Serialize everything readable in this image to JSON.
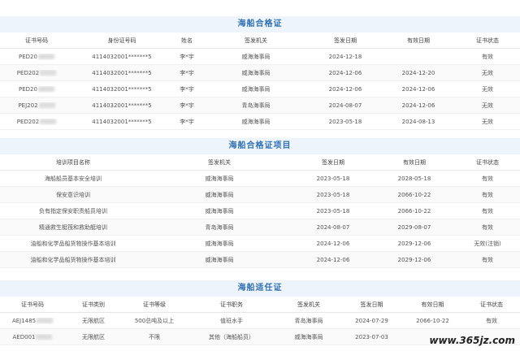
{
  "sec1": {
    "title": "海船合格证",
    "headers": [
      "证书号码",
      "身份证号码",
      "姓名",
      "签发机关",
      "签发日期",
      "有效日期",
      "证书状态"
    ],
    "rows": [
      [
        "PED20",
        "4114032001*******5",
        "李*宇",
        "威海海事局",
        "2024-12-18",
        "",
        "有效"
      ],
      [
        "PED202",
        "4114032001*******5",
        "李*宇",
        "威海海事局",
        "2024-12-06",
        "2024-12-20",
        "无效"
      ],
      [
        "PED20",
        "4114032001*******5",
        "李*宇",
        "威海海事局",
        "2024-12-06",
        "2024-12-06",
        "无效"
      ],
      [
        "PEJ202",
        "4114032001*******5",
        "李*宇",
        "青岛海事局",
        "2024-08-07",
        "2024-12-06",
        "无效"
      ],
      [
        "PED202",
        "4114032001*******5",
        "李*宇",
        "威海海事局",
        "2023-05-18",
        "2024-08-13",
        "无效"
      ]
    ]
  },
  "sec2": {
    "title": "海船合格证项目",
    "headers": [
      "培训项目名称",
      "签发机关",
      "签发日期",
      "有效日期",
      "证书状态"
    ],
    "rows": [
      [
        "海船船员基本安全培训",
        "威海海事局",
        "2023-05-18",
        "2028-05-18",
        "有效"
      ],
      [
        "保安意识培训",
        "威海海事局",
        "2023-05-18",
        "2066-10-22",
        "有效"
      ],
      [
        "负有指定保安职责船员培训",
        "威海海事局",
        "2023-05-18",
        "2066-10-22",
        "有效"
      ],
      [
        "精通救生艇筏和救助艇培训",
        "青岛海事局",
        "2024-08-07",
        "2029-08-07",
        "有效"
      ],
      [
        "油船和化学品船货物操作基本培训",
        "威海海事局",
        "2024-12-06",
        "2029-12-06",
        "无效(注销)"
      ],
      [
        "油船和化学品船货物操作基本培训",
        "威海海事局",
        "2024-12-06",
        "2029-12-06",
        "有效"
      ]
    ]
  },
  "sec3": {
    "title": "海船适任证",
    "headers": [
      "证书号码",
      "证书类别",
      "证书等级",
      "证书职务",
      "签发机关",
      "签发日期",
      "有效日期",
      "证书状态"
    ],
    "rows": [
      [
        "AEJ1485",
        "无限航区",
        "500总吨及以上",
        "值班水手",
        "青岛海事局",
        "2024-07-29",
        "2066-10-22",
        "有效"
      ],
      [
        "AED001",
        "无限航区",
        "不限",
        "其他（海船船员）",
        "威海海事局",
        "2023-07-03",
        "",
        ""
      ]
    ]
  },
  "watermark": "www.365jz.com"
}
